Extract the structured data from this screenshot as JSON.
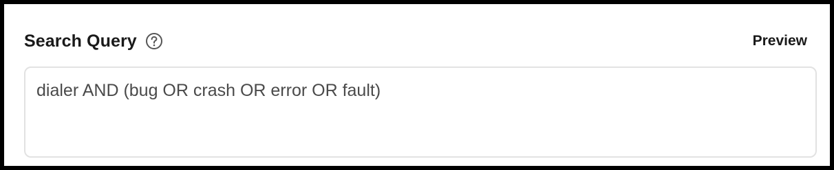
{
  "header": {
    "title": "Search Query",
    "help_icon": "question-circle-icon",
    "preview_label": "Preview"
  },
  "query": {
    "value": "dialer AND (bug OR crash OR error OR fault)"
  }
}
